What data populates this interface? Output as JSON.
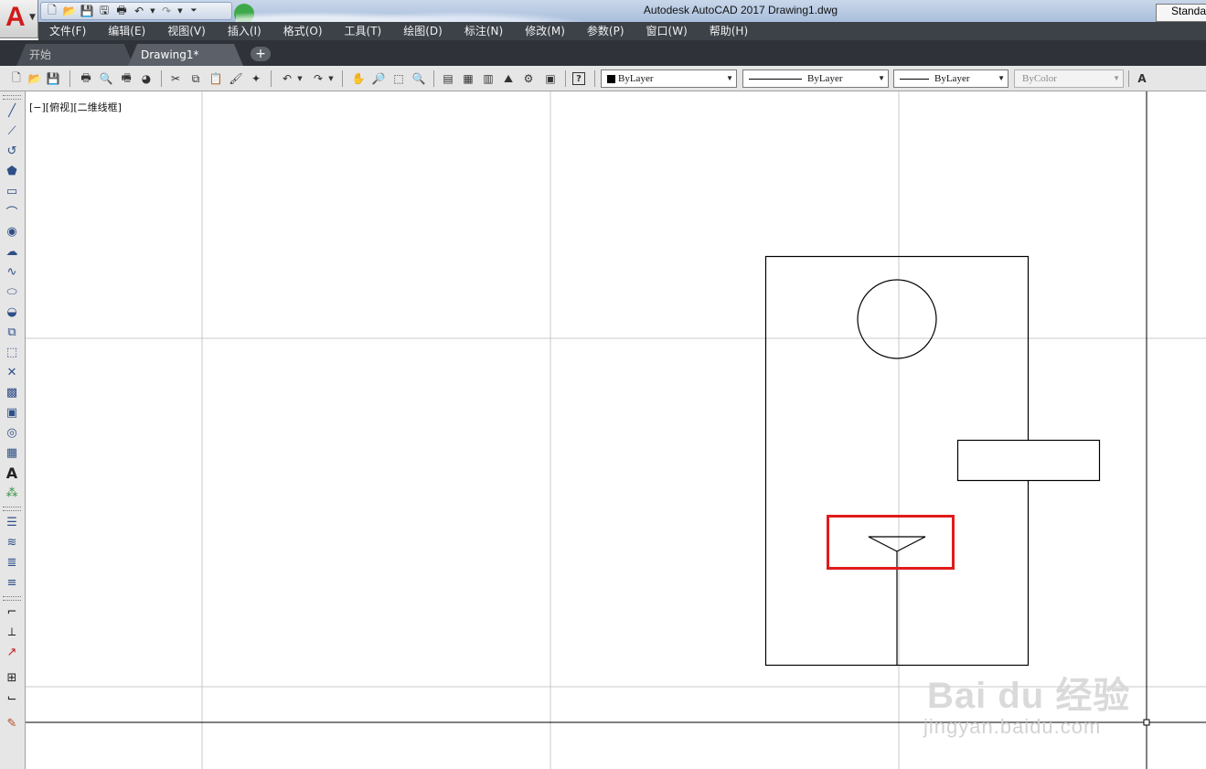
{
  "app": {
    "title": "Autodesk AutoCAD 2017    Drawing1.dwg",
    "logo_letter": "A"
  },
  "menu": {
    "items": [
      "文件(F)",
      "编辑(E)",
      "视图(V)",
      "插入(I)",
      "格式(O)",
      "工具(T)",
      "绘图(D)",
      "标注(N)",
      "修改(M)",
      "参数(P)",
      "窗口(W)",
      "帮助(H)"
    ]
  },
  "tabs": {
    "start": "开始",
    "drawing": "Drawing1*",
    "add": "+"
  },
  "toolbar": {
    "color_combo": "ByLayer",
    "linetype_combo": "ByLayer",
    "lineweight_combo": "ByLayer",
    "plotstyle_combo": "ByColor",
    "text_style": "Standa"
  },
  "viewport": {
    "label": "[−][俯视][二维线框]"
  },
  "watermark": {
    "text": "Bai  du 经验",
    "url": "jingyan.baidu.com"
  },
  "colors": {
    "menubar": "#3d4249",
    "highlight": "#e11b1b",
    "draw_icons": "#2e4f86"
  }
}
